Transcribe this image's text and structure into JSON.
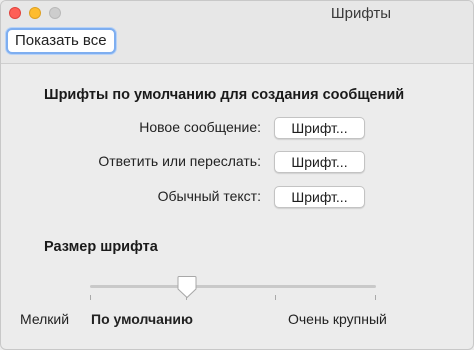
{
  "window": {
    "title": "Шрифты"
  },
  "toolbar": {
    "show_all_label": "Показать все"
  },
  "defaults_section": {
    "title": "Шрифты по умолчанию для создания сообщений",
    "rows": [
      {
        "label": "Новое сообщение:",
        "button": "Шрифт..."
      },
      {
        "label": "Ответить или переслать:",
        "button": "Шрифт..."
      },
      {
        "label": "Обычный текст:",
        "button": "Шрифт..."
      }
    ]
  },
  "font_size": {
    "title": "Размер шрифта",
    "selected_step": 1,
    "step_count": 5,
    "labels": {
      "small": "Мелкий",
      "default": "По умолчанию",
      "very_large": "Очень крупный"
    }
  }
}
